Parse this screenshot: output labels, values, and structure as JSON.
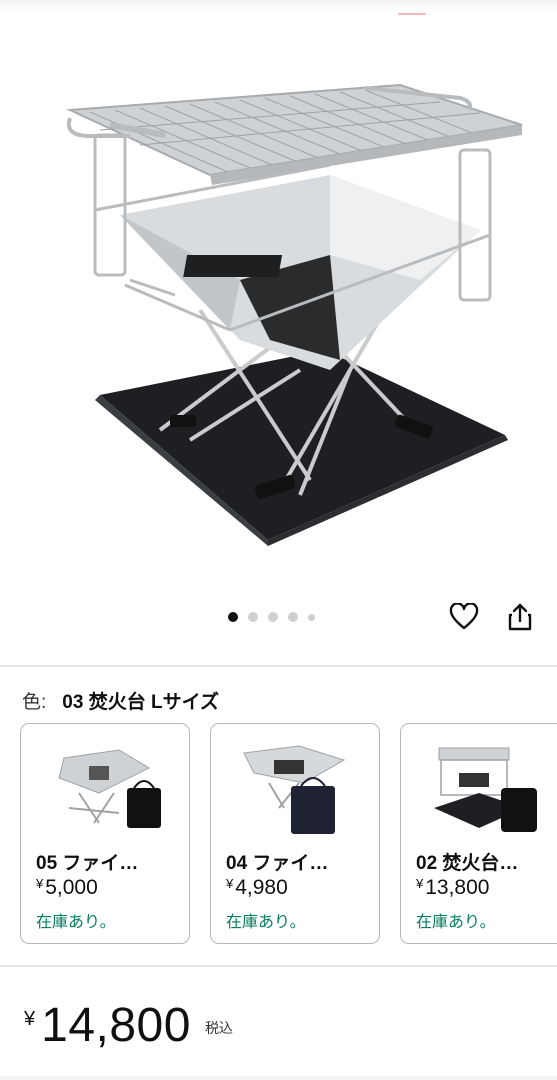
{
  "gallery": {
    "image_alt": "焚火台 Lサイズ",
    "dot_count": 5,
    "active_dot": 0
  },
  "actions": {
    "favorite_icon": "heart-icon",
    "share_icon": "share-icon"
  },
  "variation": {
    "label": "色:",
    "selected": "03 焚火台 Lサイズ"
  },
  "swatches": [
    {
      "name": "05 ファイ…",
      "price_symbol": "¥",
      "price": "5,000",
      "stock": "在庫あり。"
    },
    {
      "name": "04 ファイ…",
      "price_symbol": "¥",
      "price": "4,980",
      "stock": "在庫あり。"
    },
    {
      "name": "02 焚火台…",
      "price_symbol": "¥",
      "price": "13,800",
      "stock": "在庫あり。"
    }
  ],
  "price": {
    "symbol": "¥",
    "amount": "14,800",
    "tax_note": "税込"
  },
  "colors": {
    "stock_green": "#067d62",
    "text": "#0f1111",
    "border": "#b6b8b8"
  }
}
